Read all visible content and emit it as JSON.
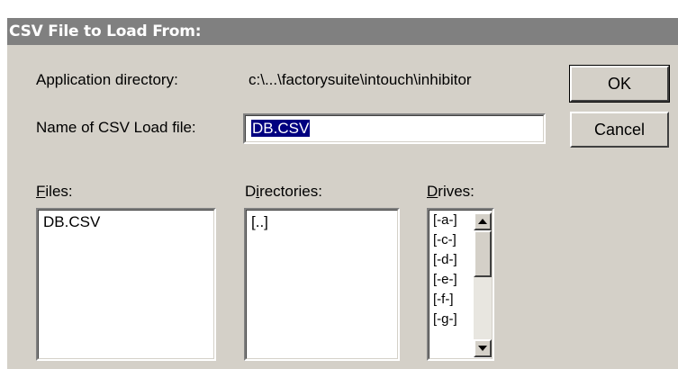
{
  "title": "CSV File to Load From:",
  "app_dir": {
    "label": "Application directory:",
    "value": "c:\\...\\factorysuite\\intouch\\inhibitor"
  },
  "csv_name": {
    "label": "Name of CSV Load file:",
    "value": "DB.CSV"
  },
  "buttons": {
    "ok": "OK",
    "cancel": "Cancel"
  },
  "files": {
    "label_accel": "F",
    "label_rest": "iles:",
    "items": [
      "DB.CSV"
    ]
  },
  "directories": {
    "label_pre": "D",
    "label_accel": "i",
    "label_rest": "rectories:",
    "items": [
      "[..]"
    ]
  },
  "drives": {
    "label_accel": "D",
    "label_rest": "rives:",
    "items": [
      "[-a-]",
      "[-c-]",
      "[-d-]",
      "[-e-]",
      "[-f-]",
      "[-g-]"
    ]
  },
  "colors": {
    "titlebar": "#808080",
    "dialog": "#d4d0c8",
    "selection": "#000080"
  }
}
